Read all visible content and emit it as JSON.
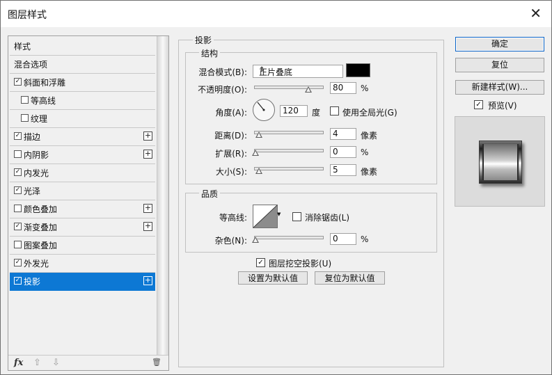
{
  "window": {
    "title": "图层样式",
    "close": "✕"
  },
  "list": {
    "items": [
      {
        "label": "样式",
        "check": false,
        "hasCheck": false,
        "plus": false,
        "selected": false
      },
      {
        "label": "混合选项",
        "check": false,
        "hasCheck": false,
        "plus": false,
        "selected": false
      },
      {
        "label": "斜面和浮雕",
        "check": true,
        "hasCheck": true,
        "plus": false,
        "selected": false
      },
      {
        "label": "等高线",
        "check": false,
        "hasCheck": true,
        "plus": false,
        "selected": false,
        "indent": true
      },
      {
        "label": "纹理",
        "check": false,
        "hasCheck": true,
        "plus": false,
        "selected": false,
        "indent": true
      },
      {
        "label": "描边",
        "check": true,
        "hasCheck": true,
        "plus": true,
        "selected": false
      },
      {
        "label": "内阴影",
        "check": false,
        "hasCheck": true,
        "plus": true,
        "selected": false
      },
      {
        "label": "内发光",
        "check": true,
        "hasCheck": true,
        "plus": false,
        "selected": false
      },
      {
        "label": "光泽",
        "check": true,
        "hasCheck": true,
        "plus": false,
        "selected": false
      },
      {
        "label": "颜色叠加",
        "check": false,
        "hasCheck": true,
        "plus": true,
        "selected": false
      },
      {
        "label": "渐变叠加",
        "check": true,
        "hasCheck": true,
        "plus": true,
        "selected": false
      },
      {
        "label": "图案叠加",
        "check": false,
        "hasCheck": true,
        "plus": false,
        "selected": false
      },
      {
        "label": "外发光",
        "check": true,
        "hasCheck": true,
        "plus": false,
        "selected": false
      },
      {
        "label": "投影",
        "check": true,
        "hasCheck": true,
        "plus": true,
        "selected": true
      }
    ],
    "bottom": {
      "fx": "fx",
      "up": "⇧",
      "down": "⇩",
      "trash": "🗑"
    }
  },
  "shadow": {
    "group_title": "投影",
    "structure": {
      "title": "结构",
      "blend_label": "混合模式(B):",
      "blend_value": "正片叠底",
      "blend_arrow": "⇕",
      "color": "#000000",
      "opacity_label": "不透明度(O):",
      "opacity_value": "80",
      "opacity_unit": "%",
      "opacity_level": 0.8,
      "angle_label": "角度(A):",
      "angle_value": "120",
      "angle_unit": "度",
      "global_light_label": "使用全局光(G)",
      "global_light_checked": false,
      "distance_label": "距离(D):",
      "distance_value": "4",
      "distance_unit": "像素",
      "spread_label": "扩展(R):",
      "spread_value": "0",
      "spread_unit": "%",
      "size_label": "大小(S):",
      "size_value": "5",
      "size_unit": "像素"
    },
    "quality": {
      "title": "品质",
      "contour_label": "等高线:",
      "antialias_label": "消除锯齿(L)",
      "antialias_checked": false,
      "noise_label": "杂色(N):",
      "noise_value": "0",
      "noise_unit": "%"
    },
    "knockout_label": "图层挖空投影(U)",
    "knockout_checked": true,
    "set_default_label": "设置为默认值",
    "reset_default_label": "复位为默认值"
  },
  "buttons": {
    "ok": "确定",
    "reset": "复位",
    "new_style": "新建样式(W)...",
    "preview_label": "预览(V)",
    "preview_checked": true
  },
  "checkmark": "✓"
}
